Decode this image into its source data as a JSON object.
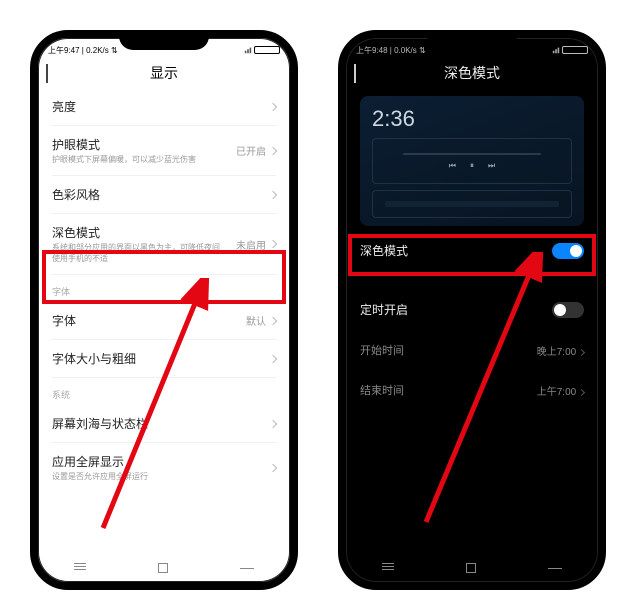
{
  "left_phone": {
    "status_left": "上午9:47 | 0.2K/s ⇅",
    "header_title": "显示",
    "rows": {
      "brightness": {
        "label": "亮度"
      },
      "eyecare": {
        "label": "护眼模式",
        "sub": "护眼模式下屏幕偏暖，可以减少蓝光伤害",
        "value": "已开启"
      },
      "color": {
        "label": "色彩风格"
      },
      "darkmode": {
        "label": "深色模式",
        "sub": "系统和部分应用的界面以黑色为主，可降低夜间使用手机的不适",
        "value": "未启用"
      },
      "section_font": "字体",
      "font": {
        "label": "字体",
        "value": "默认"
      },
      "fontsize": {
        "label": "字体大小与粗细"
      },
      "section_system": "系统",
      "notch": {
        "label": "屏幕刘海与状态栏"
      },
      "fullscreen": {
        "label": "应用全屏显示",
        "sub": "设置是否允许应用全屏运行"
      }
    }
  },
  "right_phone": {
    "status_left": "上午9:48 | 0.0K/s ⇅",
    "header_title": "深色模式",
    "preview_time": "2:36",
    "rows": {
      "darkmode": {
        "label": "深色模式"
      },
      "schedule": {
        "label": "定时开启"
      },
      "start": {
        "label": "开始时间",
        "value": "晚上7:00"
      },
      "end": {
        "label": "结束时间",
        "value": "上午7:00"
      }
    }
  }
}
